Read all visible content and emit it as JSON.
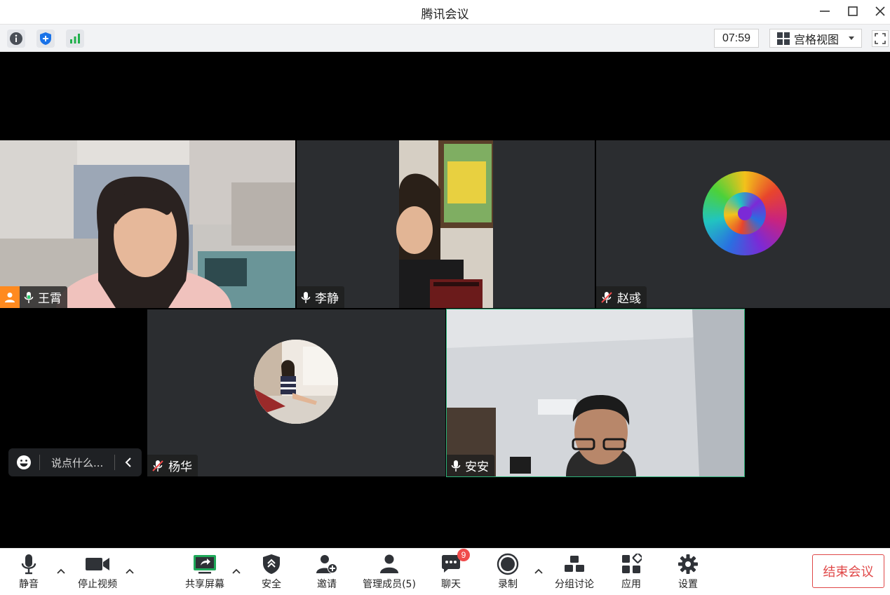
{
  "window": {
    "title": "腾讯会议"
  },
  "infobar": {
    "timer": "07:59",
    "view_label": "宫格视图",
    "icons": [
      "info-icon",
      "shield-icon",
      "signal-icon",
      "grid-view-icon",
      "fullscreen-icon"
    ]
  },
  "participants": [
    {
      "name": "王霄",
      "mic": "on",
      "host": true,
      "video": "camera"
    },
    {
      "name": "李静",
      "mic": "on",
      "host": false,
      "video": "camera"
    },
    {
      "name": "赵彧",
      "mic": "muted",
      "host": false,
      "video": "avatar"
    },
    {
      "name": "杨华",
      "mic": "muted",
      "host": false,
      "video": "avatar"
    },
    {
      "name": "安安",
      "mic": "on",
      "host": false,
      "video": "camera",
      "active": true
    }
  ],
  "chat": {
    "placeholder": "说点什么..."
  },
  "toolbar": {
    "mute": "静音",
    "stop_video": "停止视频",
    "share_screen": "共享屏幕",
    "security": "安全",
    "invite": "邀请",
    "manage_members": "管理成员(5)",
    "chat": "聊天",
    "chat_badge": "9",
    "record": "录制",
    "breakout": "分组讨论",
    "apps": "应用",
    "settings": "设置",
    "end_meeting": "结束会议"
  },
  "colors": {
    "accent_green": "#2db37a",
    "end_red": "#e04848",
    "host_orange": "#ff8a1f",
    "tile_bg": "#2b2d30"
  }
}
